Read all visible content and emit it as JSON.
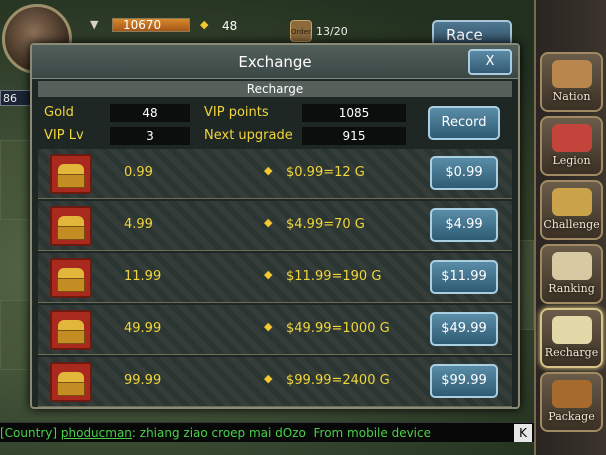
{
  "topbar": {
    "player_level": "86",
    "silver": "10670",
    "gold": "48",
    "building_icon_text": "Order",
    "building_count": "13/20",
    "race_label": "Race"
  },
  "dialog": {
    "title": "Exchange",
    "close_label": "X",
    "section_label": "Recharge",
    "summary": {
      "gold_label": "Gold",
      "gold_value": "48",
      "vip_points_label": "VIP points",
      "vip_points_value": "1085",
      "vip_lv_label": "VIP Lv",
      "vip_lv_value": "3",
      "next_upgrade_label": "Next upgrade",
      "next_upgrade_value": "915",
      "record_label": "Record"
    },
    "rows": [
      {
        "price": "0.99",
        "rate": "$0.99=12 G",
        "button": "$0.99"
      },
      {
        "price": "4.99",
        "rate": "$4.99=70 G",
        "button": "$4.99"
      },
      {
        "price": "11.99",
        "rate": "$11.99=190 G",
        "button": "$11.99"
      },
      {
        "price": "49.99",
        "rate": "$49.99=1000 G",
        "button": "$49.99"
      },
      {
        "price": "99.99",
        "rate": "$99.99=2400 G",
        "button": "$99.99"
      }
    ]
  },
  "menu": [
    {
      "label": "Nation",
      "icon": "nation-icon",
      "color": "#b9874d"
    },
    {
      "label": "Legion",
      "icon": "legion-icon",
      "color": "#c2443a"
    },
    {
      "label": "Challenge",
      "icon": "challenge-icon",
      "color": "#c9a24a"
    },
    {
      "label": "Ranking",
      "icon": "ranking-icon",
      "color": "#d7c9a2"
    },
    {
      "label": "Recharge",
      "icon": "recharge-icon",
      "color": "#e3d9a8"
    },
    {
      "label": "Package",
      "icon": "package-icon",
      "color": "#a66a2c"
    }
  ],
  "chat": {
    "channel": "[Country]",
    "user": "phoducman",
    "message": ": zhiang ziao croep mai dOzo",
    "suffix": "From mobile device",
    "toggle": "K"
  },
  "colors": {
    "label_yellow": "#f1d63c",
    "button_blue": "#2e5b73",
    "chat_green": "#49d14a"
  }
}
